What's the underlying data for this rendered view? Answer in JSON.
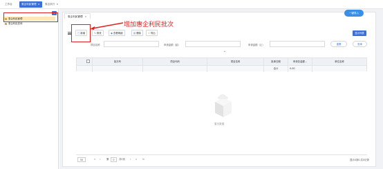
{
  "top_tabs": [
    {
      "label": "工作台",
      "close": ""
    },
    {
      "label": "惠企利民管理",
      "close": "×"
    },
    {
      "label": "惠企执行",
      "close": "×"
    }
  ],
  "sidebar": {
    "collapse_icon": "«",
    "items": [
      {
        "label": "惠企利民管理",
        "selected": true
      },
      {
        "label": "惠企利民查询",
        "selected": false
      }
    ]
  },
  "panel_tab": {
    "label": "惠企利民管理",
    "close": "×"
  },
  "header_button": "一键导入",
  "annotation": "增加惠企利民批次",
  "toolbar": [
    {
      "icon": "□",
      "label": "新增"
    },
    {
      "icon": "✎",
      "label": "修改"
    },
    {
      "icon": "◉",
      "label": "查看明细"
    },
    {
      "icon": "▥",
      "label": "删除"
    },
    {
      "icon": "⇪",
      "label": "导出"
    }
  ],
  "display_button": "显示列表",
  "filters": {
    "f1_label": "项目名称",
    "f2_label": "申请金额（起）",
    "f3_label": "申请金额（止）",
    "reset": "重置",
    "search": "查询"
  },
  "expand_icon": "⌄",
  "table": {
    "columns": [
      "批次号",
      "项目代码",
      "项目名称",
      "批单日期",
      "申请总金额...",
      "单位名称"
    ],
    "sum_label": "合计",
    "sum_value": "0.00"
  },
  "empty_text": "暂无数据",
  "pager": {
    "page_size": "50",
    "nav_first": "«",
    "nav_prev": "‹",
    "page_prefix": "第",
    "page_num": "0",
    "page_suffix": "共0页",
    "nav_next": "›",
    "nav_last": "»",
    "refresh": "↻",
    "info": "显示0到0,共0记录"
  }
}
